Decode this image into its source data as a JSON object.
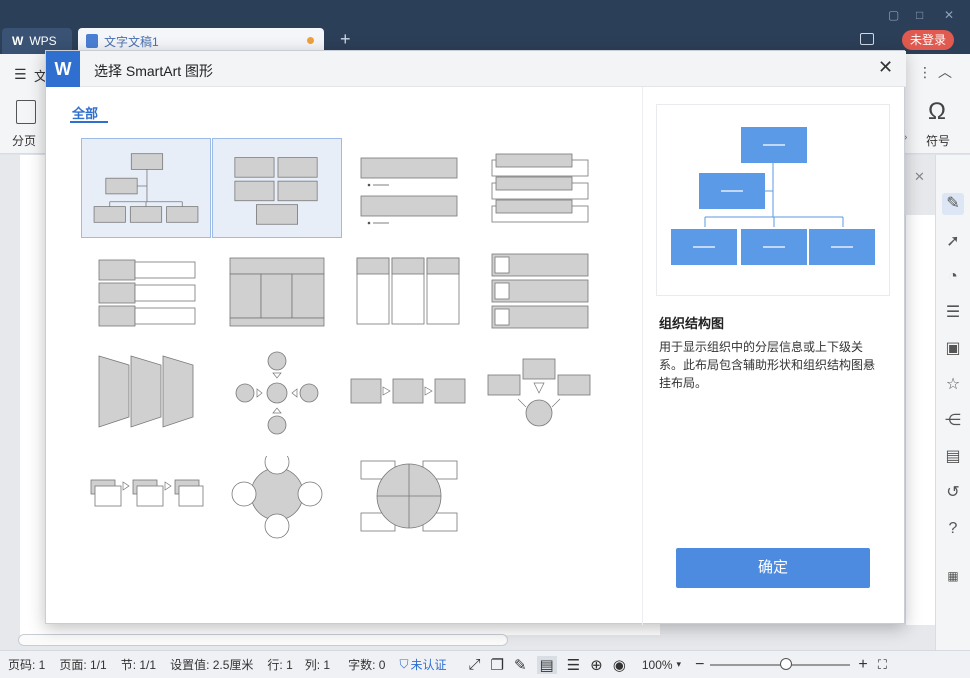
{
  "app": {
    "wps_tab_label": "WPS",
    "doc_tab_label": "文字文稿1",
    "login_label": "未登录"
  },
  "ribbon": {
    "menu_label": "文",
    "page_break_label": "分页",
    "symbol_label": "符号"
  },
  "dialog": {
    "title": "选择 SmartArt 图形",
    "category_label": "全部",
    "selected_name": "组织结构图",
    "selected_description": "用于显示组织中的分层信息或上下级关系。此布局包含辅助形状和组织结构图悬挂布局。",
    "ok_label": "确定"
  },
  "statusbar": {
    "page_num": "页码: 1",
    "pages": "页面: 1/1",
    "section": "节: 1/1",
    "setting": "设置值: 2.5厘米",
    "row": "行: 1",
    "col": "列: 1",
    "word_count": "字数: 0",
    "auth": "未认证",
    "zoom": "100%"
  },
  "colors": {
    "accent": "#2f6fd0",
    "preview_fill": "#5b9ae6",
    "thumb_fill": "#cfcfcf",
    "titlebar": "#2c3f58"
  }
}
